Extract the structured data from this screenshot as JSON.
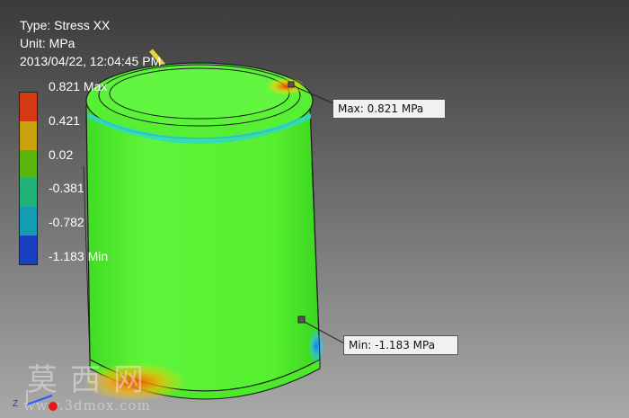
{
  "result": {
    "type_line": "Type: Stress XX",
    "unit_line": "Unit: MPa",
    "date_line": "2013/04/22, 12:04:45 PM"
  },
  "legend": {
    "labels": [
      "0.821 Max",
      "0.421",
      "0.02",
      "-0.381",
      "-0.782",
      "-1.183 Min"
    ],
    "colors": [
      "#d63a14",
      "#c6a30c",
      "#59b60f",
      "#22b37a",
      "#149cb3",
      "#1a3fc0"
    ]
  },
  "callouts": {
    "max": "Max: 0.821 MPa",
    "min": "Min: -1.183 MPa"
  },
  "model": {
    "base_color": "#4df32b",
    "hot_color": "#ff5a00",
    "cold_color": "#1f8fff"
  },
  "watermark": {
    "chinese": "莫西网",
    "url": "www.3dmox.com"
  },
  "triad": {
    "axis_z": "Z"
  }
}
